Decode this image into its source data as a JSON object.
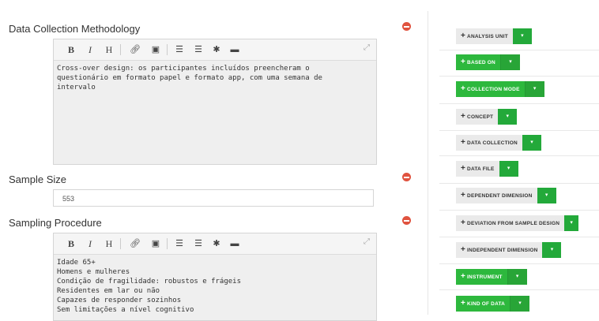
{
  "fields": {
    "methodology": {
      "label": "Data Collection Methodology",
      "text": "Cross-over design: os participantes incluídos preencheram o\nquestionário em formato papel e formato app, com uma semana de\nintervalo"
    },
    "sample_size": {
      "label": "Sample Size",
      "value": "553"
    },
    "sampling": {
      "label": "Sampling Procedure",
      "text": "Idade 65+\nHomens e mulheres\nCondição de fragilidade: robustos e frágeis\nResidentes em lar ou não\nCapazes de responder sozinhos\nSem limitações a nível cognitivo"
    }
  },
  "toolbar": {
    "bold": "B",
    "italic": "I",
    "heading": "H"
  },
  "sidebar": {
    "items": [
      {
        "label": "ANALYSIS UNIT",
        "style": "gray"
      },
      {
        "label": "BASED ON",
        "style": "green"
      },
      {
        "label": "COLLECTION MODE",
        "style": "green"
      },
      {
        "label": "CONCEPT",
        "style": "gray"
      },
      {
        "label": "DATA COLLECTION",
        "style": "gray"
      },
      {
        "label": "DATA FILE",
        "style": "gray"
      },
      {
        "label": "DEPENDENT DIMENSION",
        "style": "gray"
      },
      {
        "label": "DEVIATION FROM SAMPLE DESIGN",
        "style": "gray"
      },
      {
        "label": "INDEPENDENT DIMENSION",
        "style": "gray"
      },
      {
        "label": "INSTRUMENT",
        "style": "green"
      },
      {
        "label": "KIND OF DATA",
        "style": "green"
      }
    ]
  }
}
